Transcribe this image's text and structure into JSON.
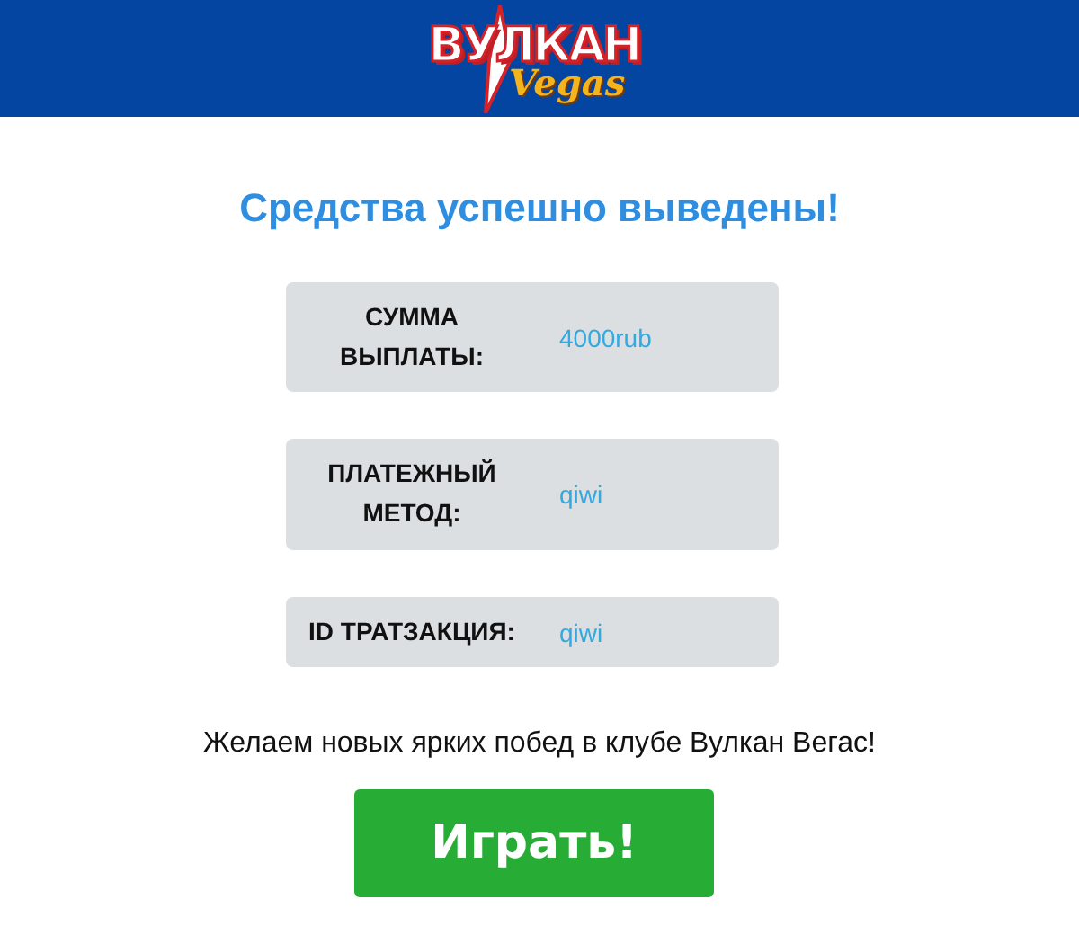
{
  "header": {
    "logo": {
      "brand": "ВУЛКАН",
      "subbrand": "Vegas"
    }
  },
  "title": "Средства успешно выведены!",
  "details": [
    {
      "label": "СУММА ВЫПЛАТЫ:",
      "value": "4000rub"
    },
    {
      "label": "ПЛАТЕЖНЫЙ МЕТОД:",
      "value": "qiwi"
    },
    {
      "label": "ID ТРАТЗАКЦИЯ:",
      "value": "qiwi"
    }
  ],
  "message": "Желаем новых ярких побед в клубе Вулкан Вегас!",
  "button": "Играть!"
}
